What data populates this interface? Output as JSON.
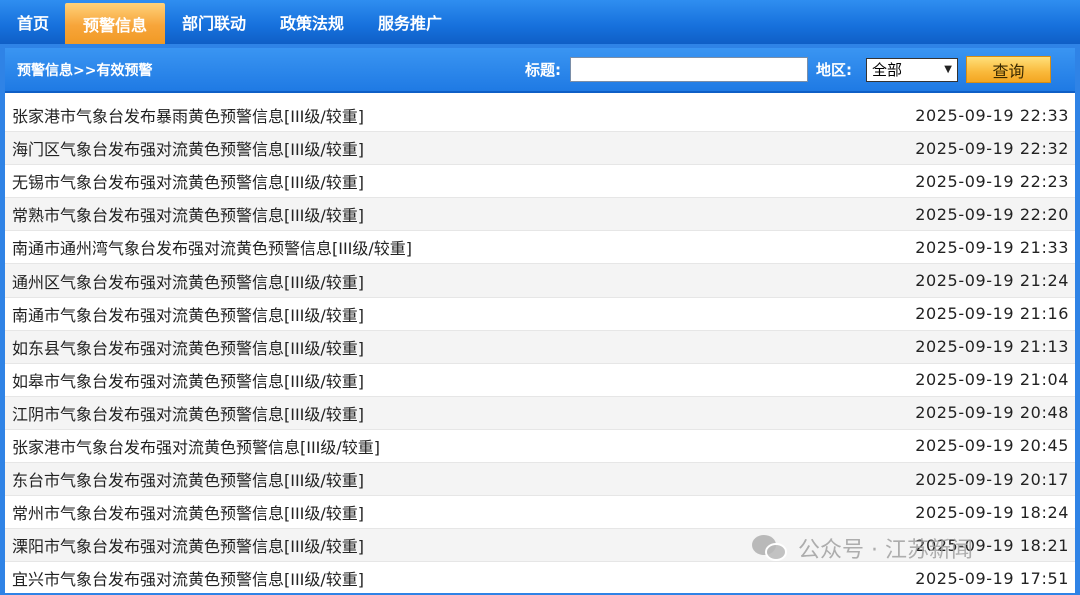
{
  "nav": {
    "items": [
      "首页",
      "预警信息",
      "部门联动",
      "政策法规",
      "服务推广"
    ],
    "active_index": 1
  },
  "toolbar": {
    "breadcrumb": "预警信息>>有效预警",
    "title_label": "标题:",
    "title_value": "",
    "region_label": "地区:",
    "region_selected": "全部",
    "query_label": "查询"
  },
  "alerts": [
    {
      "title": "张家港市气象台发布暴雨黄色预警信息[III级/较重]",
      "time": "2025-09-19 22:33"
    },
    {
      "title": "海门区气象台发布强对流黄色预警信息[III级/较重]",
      "time": "2025-09-19 22:32"
    },
    {
      "title": "无锡市气象台发布强对流黄色预警信息[III级/较重]",
      "time": "2025-09-19 22:23"
    },
    {
      "title": "常熟市气象台发布强对流黄色预警信息[III级/较重]",
      "time": "2025-09-19 22:20"
    },
    {
      "title": "南通市通州湾气象台发布强对流黄色预警信息[III级/较重]",
      "time": "2025-09-19 21:33"
    },
    {
      "title": "通州区气象台发布强对流黄色预警信息[III级/较重]",
      "time": "2025-09-19 21:24"
    },
    {
      "title": "南通市气象台发布强对流黄色预警信息[III级/较重]",
      "time": "2025-09-19 21:16"
    },
    {
      "title": "如东县气象台发布强对流黄色预警信息[III级/较重]",
      "time": "2025-09-19 21:13"
    },
    {
      "title": "如皋市气象台发布强对流黄色预警信息[III级/较重]",
      "time": "2025-09-19 21:04"
    },
    {
      "title": "江阴市气象台发布强对流黄色预警信息[III级/较重]",
      "time": "2025-09-19 20:48"
    },
    {
      "title": "张家港市气象台发布强对流黄色预警信息[III级/较重]",
      "time": "2025-09-19 20:45"
    },
    {
      "title": "东台市气象台发布强对流黄色预警信息[III级/较重]",
      "time": "2025-09-19 20:17"
    },
    {
      "title": "常州市气象台发布强对流黄色预警信息[III级/较重]",
      "time": "2025-09-19 18:24"
    },
    {
      "title": "溧阳市气象台发布强对流黄色预警信息[III级/较重]",
      "time": "2025-09-19 18:21"
    },
    {
      "title": "宜兴市气象台发布强对流黄色预警信息[III级/较重]",
      "time": "2025-09-19 17:51"
    }
  ],
  "watermark": {
    "icon": "wechat-icon",
    "text": "公众号 · 江苏新闻"
  },
  "colors": {
    "nav_blue": "#1670dc",
    "active_orange": "#f7a53a",
    "toolbar_blue": "#2f83e6",
    "button_gold": "#f9b93b"
  }
}
